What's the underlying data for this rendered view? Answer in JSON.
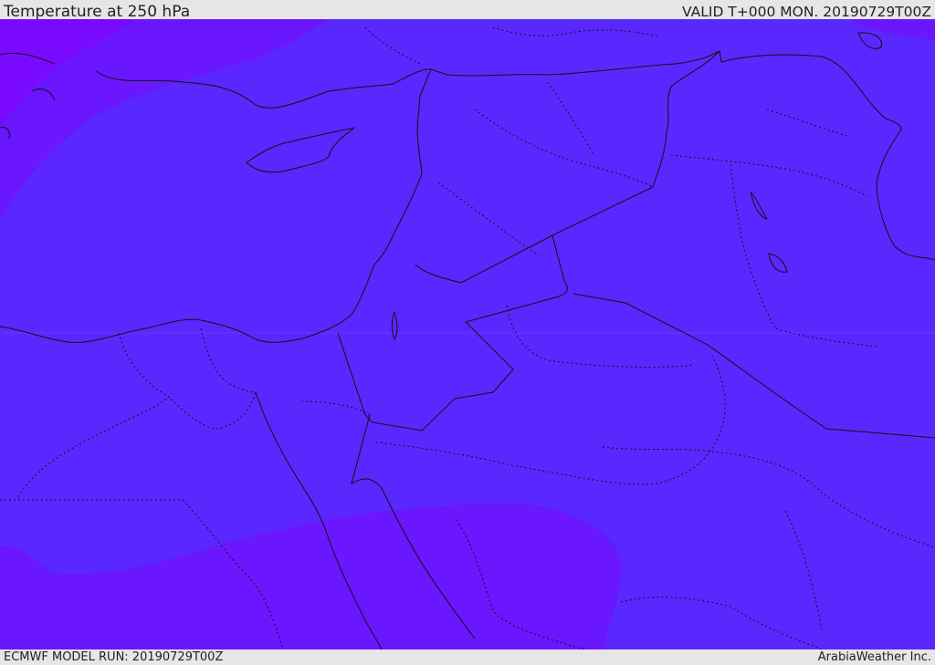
{
  "header": {
    "title": "Temperature at 250 hPa",
    "valid_time": "VALID T+000 MON. 20190729T00Z"
  },
  "footer": {
    "model_run": "ECMWF MODEL RUN: 20190729T00Z",
    "credit": "ArabiaWeather Inc."
  },
  "colors": {
    "band_main": "#5a28ff",
    "band_warm": "#6a16ff",
    "band_warmest": "#7a0aff",
    "boundary_line": "#111111",
    "frame_bg": "#e6e6e6"
  }
}
